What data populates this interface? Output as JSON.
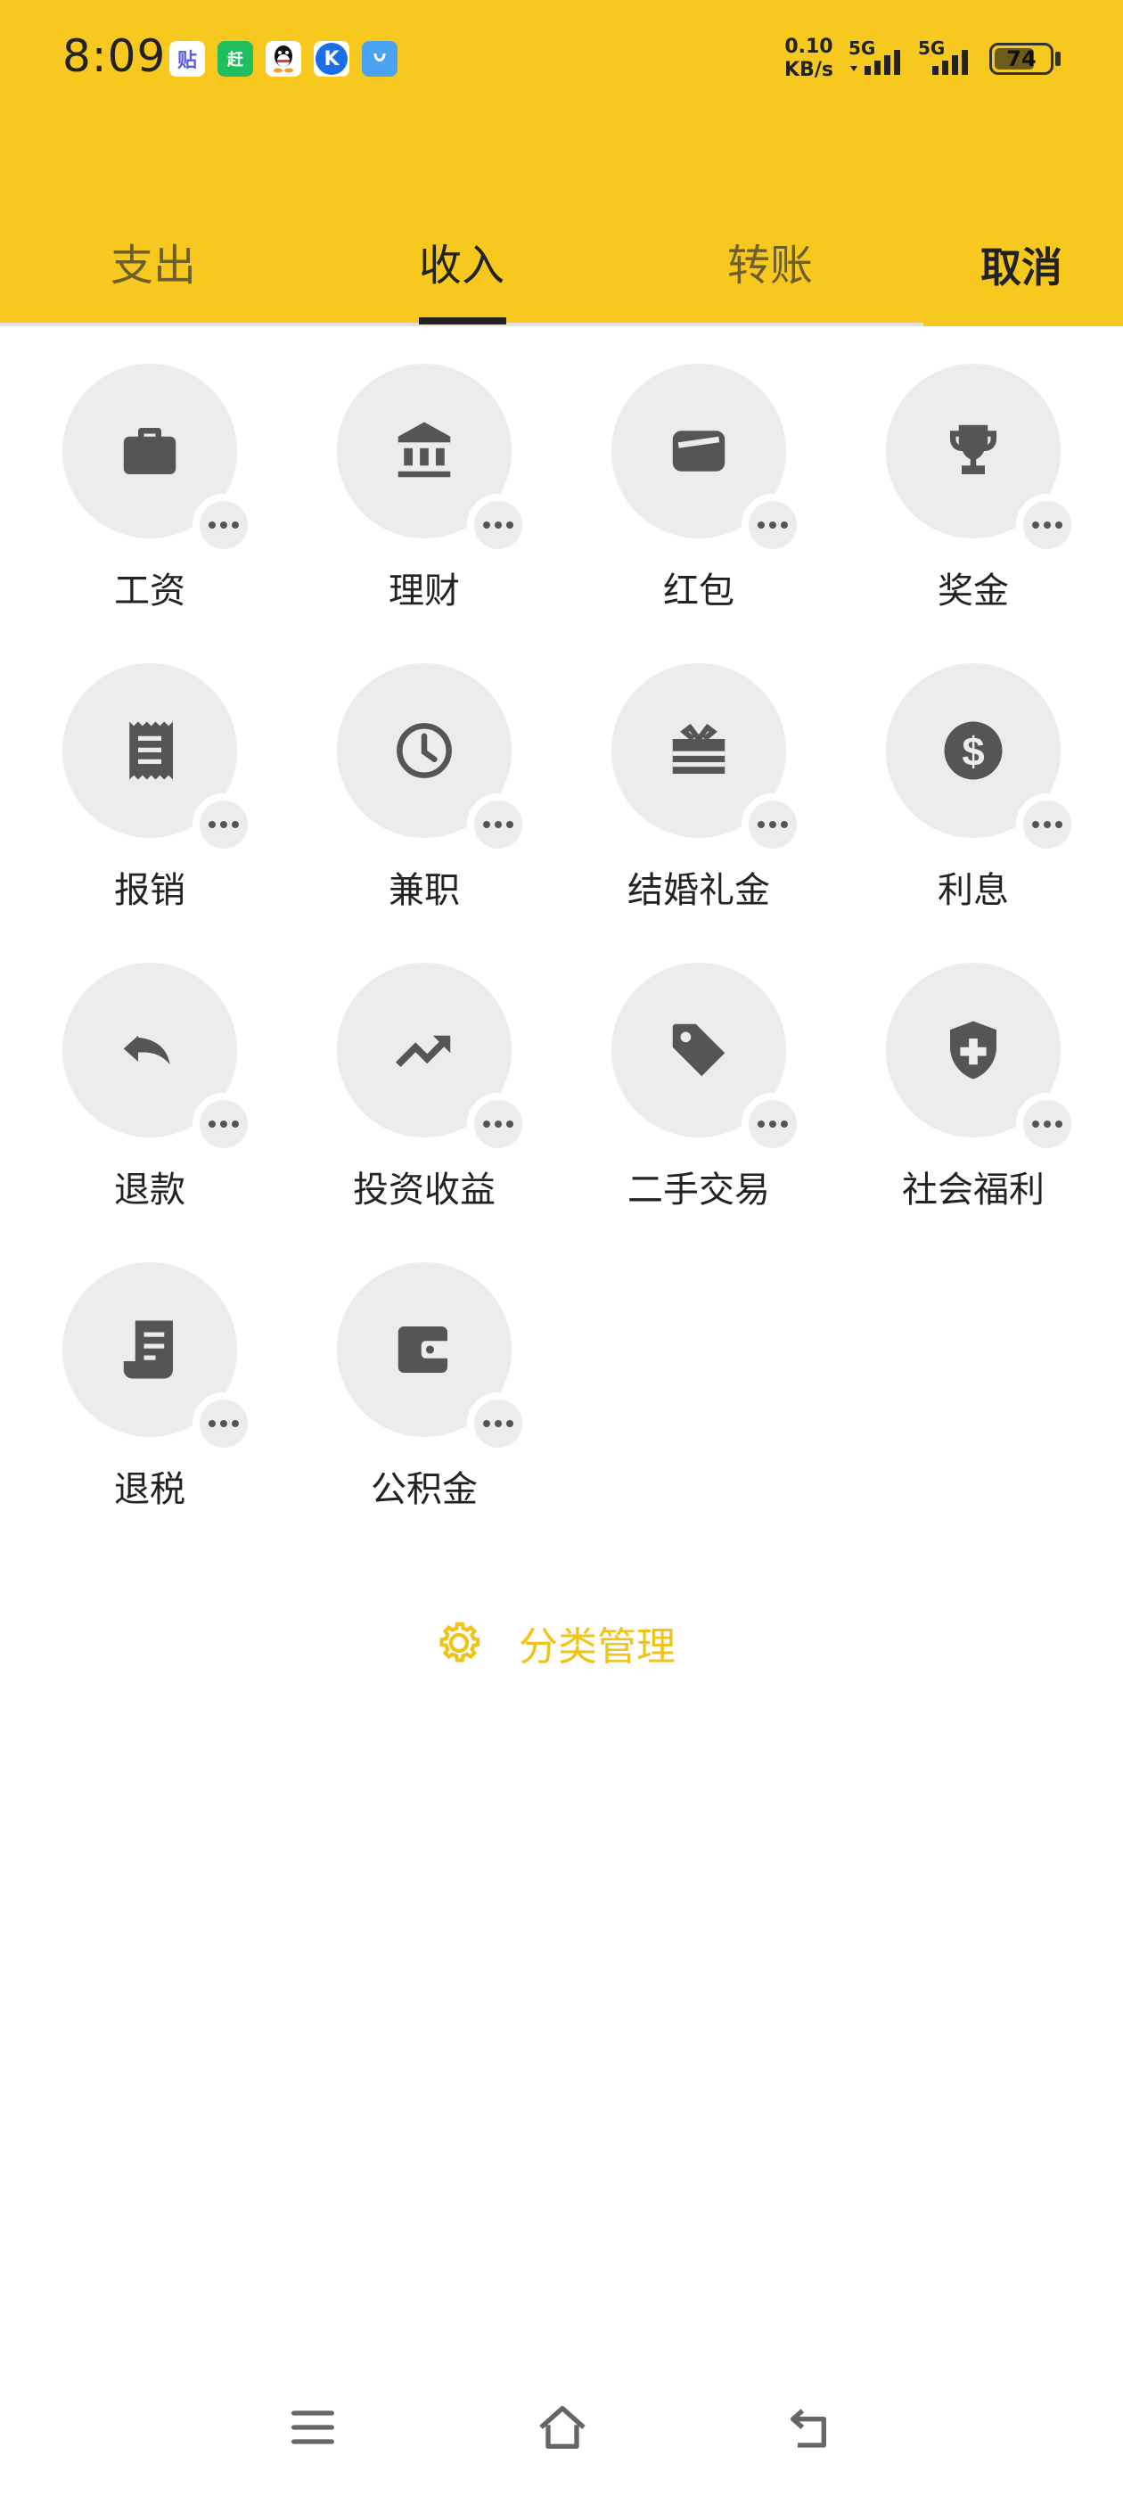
{
  "status_bar": {
    "time": "8:09",
    "net_speed_value": "0.10",
    "net_speed_unit": "KB/s",
    "sim1_label": "5G",
    "sim2_label": "5G",
    "battery_level": "74",
    "battery_fraction": 0.74,
    "notification_icons": [
      {
        "name": "tieba-app-icon",
        "text": "贴",
        "bg": "#ffffff",
        "color": "#5b5be8"
      },
      {
        "name": "kuaishou-news-app-icon",
        "text": "赶",
        "bg": "#1fbf5f",
        "color": "#ffffff"
      },
      {
        "name": "qq-app-icon",
        "text": "",
        "bg": "#ffffff",
        "color": "#000000"
      },
      {
        "name": "k-app-icon",
        "text": "K",
        "bg": "#1b6de8",
        "color": "#ffffff"
      },
      {
        "name": "blue-app-icon",
        "text": "",
        "bg": "#4aa3f0",
        "color": "#ffffff"
      }
    ]
  },
  "tabs": [
    {
      "label": "支出",
      "active": false
    },
    {
      "label": "收入",
      "active": true
    },
    {
      "label": "转账",
      "active": false
    }
  ],
  "cancel_label": "取消",
  "categories": [
    {
      "label": "工资",
      "icon": "briefcase-icon"
    },
    {
      "label": "理财",
      "icon": "bank-icon"
    },
    {
      "label": "红包",
      "icon": "wallet-card-icon"
    },
    {
      "label": "奖金",
      "icon": "trophy-icon"
    },
    {
      "label": "报销",
      "icon": "receipt-icon"
    },
    {
      "label": "兼职",
      "icon": "clock-icon"
    },
    {
      "label": "结婚礼金",
      "icon": "gift-card-icon"
    },
    {
      "label": "利息",
      "icon": "dollar-coin-icon"
    },
    {
      "label": "退款",
      "icon": "undo-icon"
    },
    {
      "label": "投资收益",
      "icon": "trending-up-icon"
    },
    {
      "label": "二手交易",
      "icon": "tag-icon"
    },
    {
      "label": "社会福利",
      "icon": "shield-plus-icon"
    },
    {
      "label": "退税",
      "icon": "tax-receipt-icon"
    },
    {
      "label": "公积金",
      "icon": "wallet-icon"
    }
  ],
  "manage_label": "分类管理",
  "colors": {
    "accent": "#F7C81E",
    "manage_text": "#F1C318",
    "icon_gray": "#555555",
    "circle_bg": "#ECECEC"
  },
  "nav": [
    "menu-icon",
    "home-icon",
    "back-icon"
  ]
}
